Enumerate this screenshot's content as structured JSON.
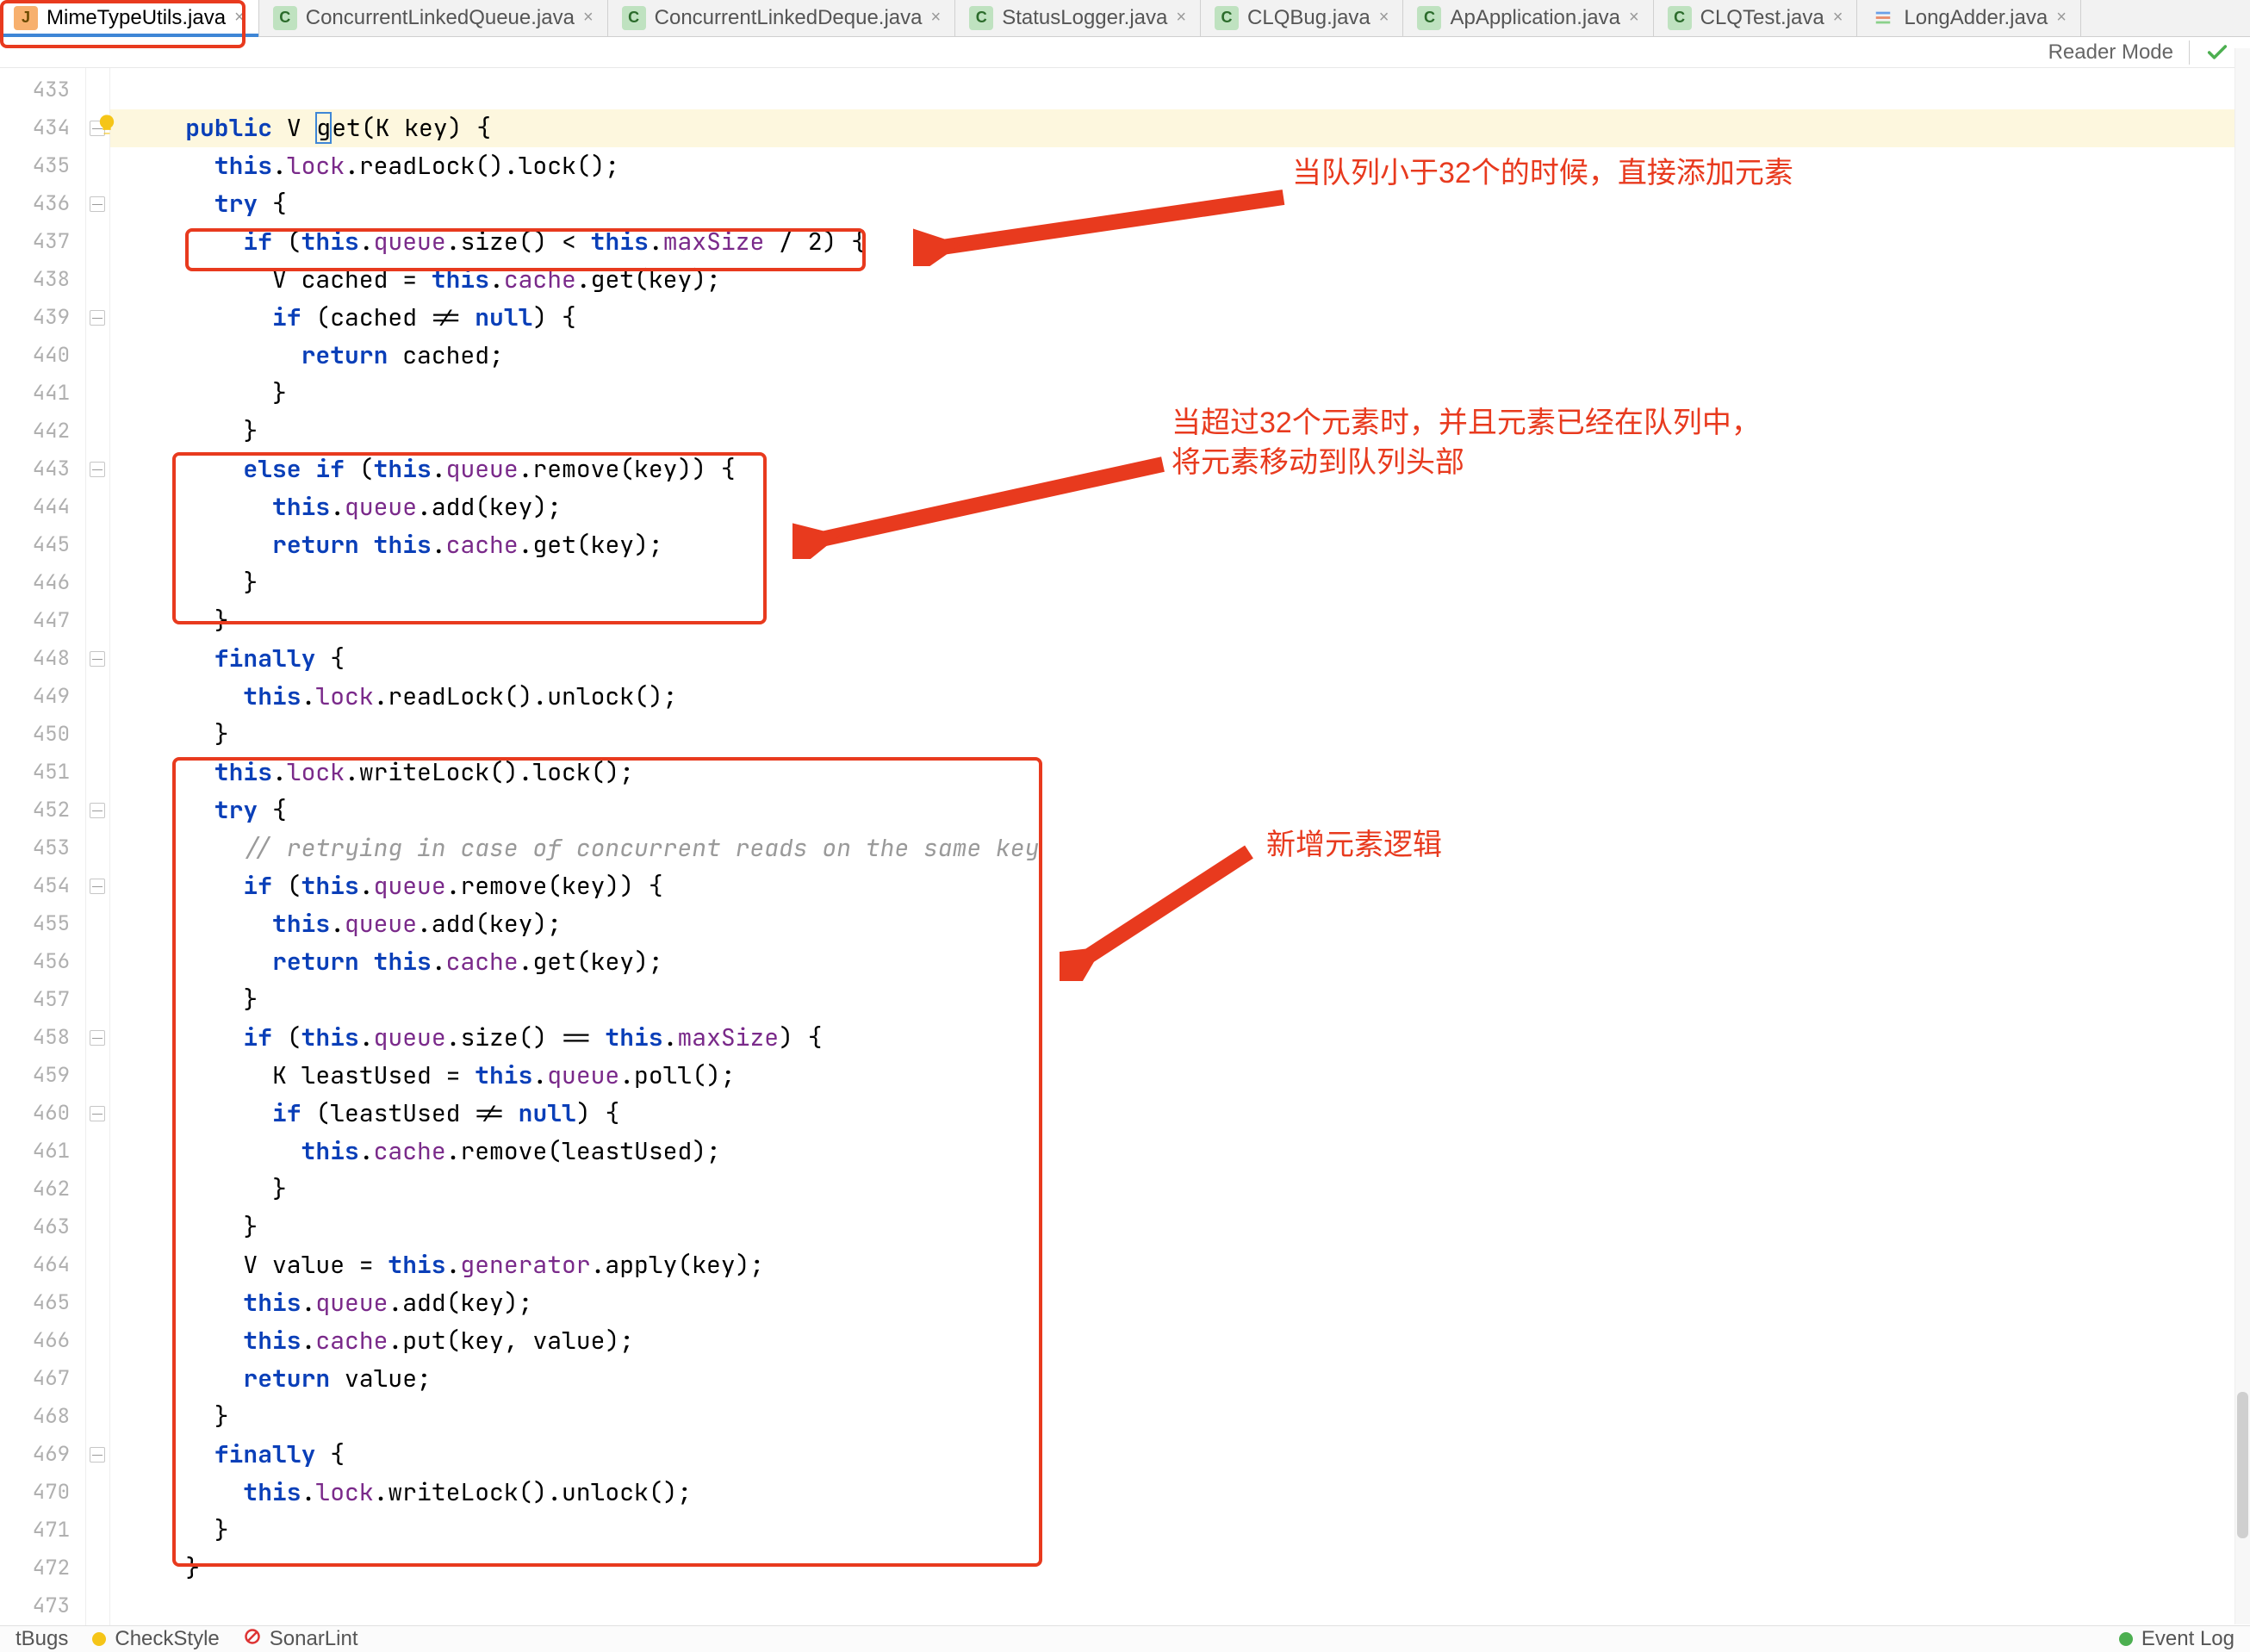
{
  "tabs": [
    {
      "label": "MimeTypeUtils.java",
      "icon": "j",
      "active": true
    },
    {
      "label": "ConcurrentLinkedQueue.java",
      "icon": "c",
      "active": false
    },
    {
      "label": "ConcurrentLinkedDeque.java",
      "icon": "c",
      "active": false
    },
    {
      "label": "StatusLogger.java",
      "icon": "c",
      "active": false
    },
    {
      "label": "CLQBug.java",
      "icon": "c",
      "active": false
    },
    {
      "label": "ApApplication.java",
      "icon": "c",
      "active": false
    },
    {
      "label": "CLQTest.java",
      "icon": "c",
      "active": false
    },
    {
      "label": "LongAdder.java",
      "icon": "bars",
      "active": false
    }
  ],
  "reader_mode_label": "Reader Mode",
  "line_start": 433,
  "line_end": 473,
  "code_lines": [
    {
      "n": 433,
      "html": ""
    },
    {
      "n": 434,
      "html": "<span class='kw'>public</span> V <span class='caret'>g</span>et(K key) {",
      "hl": true
    },
    {
      "n": 435,
      "html": "  <span class='kw'>this</span>.<span class='fld'>lock</span>.readLock().lock();"
    },
    {
      "n": 436,
      "html": "  <span class='kw'>try</span> {"
    },
    {
      "n": 437,
      "html": "    <span class='kw'>if</span> (<span class='kw'>this</span>.<span class='fld'>queue</span>.size() &lt; <span class='kw'>this</span>.<span class='fld'>maxSize</span> / 2) {"
    },
    {
      "n": 438,
      "html": "      V cached = <span class='kw'>this</span>.<span class='fld'>cache</span>.get(key);"
    },
    {
      "n": 439,
      "html": "      <span class='kw'>if</span> (cached != <span class='kw'>null</span>) {"
    },
    {
      "n": 440,
      "html": "        <span class='kw'>return</span> cached;"
    },
    {
      "n": 441,
      "html": "      }"
    },
    {
      "n": 442,
      "html": "    }"
    },
    {
      "n": 443,
      "html": "    <span class='kw'>else if</span> (<span class='kw'>this</span>.<span class='fld'>queue</span>.remove(key)) {"
    },
    {
      "n": 444,
      "html": "      <span class='kw'>this</span>.<span class='fld'>queue</span>.add(key);"
    },
    {
      "n": 445,
      "html": "      <span class='kw'>return</span> <span class='kw'>this</span>.<span class='fld'>cache</span>.get(key);"
    },
    {
      "n": 446,
      "html": "    }"
    },
    {
      "n": 447,
      "html": "  }"
    },
    {
      "n": 448,
      "html": "  <span class='kw'>finally</span> {"
    },
    {
      "n": 449,
      "html": "    <span class='kw'>this</span>.<span class='fld'>lock</span>.readLock().unlock();"
    },
    {
      "n": 450,
      "html": "  }"
    },
    {
      "n": 451,
      "html": "  <span class='kw'>this</span>.<span class='fld'>lock</span>.writeLock().lock();"
    },
    {
      "n": 452,
      "html": "  <span class='kw'>try</span> {"
    },
    {
      "n": 453,
      "html": "    <span class='cmt'>// retrying in case of concurrent reads on the same key</span>"
    },
    {
      "n": 454,
      "html": "    <span class='kw'>if</span> (<span class='kw'>this</span>.<span class='fld'>queue</span>.remove(key)) {"
    },
    {
      "n": 455,
      "html": "      <span class='kw'>this</span>.<span class='fld'>queue</span>.add(key);"
    },
    {
      "n": 456,
      "html": "      <span class='kw'>return</span> <span class='kw'>this</span>.<span class='fld'>cache</span>.get(key);"
    },
    {
      "n": 457,
      "html": "    }"
    },
    {
      "n": 458,
      "html": "    <span class='kw'>if</span> (<span class='kw'>this</span>.<span class='fld'>queue</span>.size() == <span class='kw'>this</span>.<span class='fld'>maxSize</span>) {"
    },
    {
      "n": 459,
      "html": "      K leastUsed = <span class='kw'>this</span>.<span class='fld'>queue</span>.poll();"
    },
    {
      "n": 460,
      "html": "      <span class='kw'>if</span> (leastUsed != <span class='kw'>null</span>) {"
    },
    {
      "n": 461,
      "html": "        <span class='kw'>this</span>.<span class='fld'>cache</span>.remove(leastUsed);"
    },
    {
      "n": 462,
      "html": "      }"
    },
    {
      "n": 463,
      "html": "    }"
    },
    {
      "n": 464,
      "html": "    V value = <span class='kw'>this</span>.<span class='fld'>generator</span>.apply(key);"
    },
    {
      "n": 465,
      "html": "    <span class='kw'>this</span>.<span class='fld'>queue</span>.add(key);"
    },
    {
      "n": 466,
      "html": "    <span class='kw'>this</span>.<span class='fld'>cache</span>.put(key, value);"
    },
    {
      "n": 467,
      "html": "    <span class='kw'>return</span> value;"
    },
    {
      "n": 468,
      "html": "  }"
    },
    {
      "n": 469,
      "html": "  <span class='kw'>finally</span> {"
    },
    {
      "n": 470,
      "html": "    <span class='kw'>this</span>.<span class='fld'>lock</span>.writeLock().unlock();"
    },
    {
      "n": 471,
      "html": "  }"
    },
    {
      "n": 472,
      "html": "}"
    },
    {
      "n": 473,
      "html": ""
    }
  ],
  "annotations": {
    "a1": "当队列小于32个的时候，直接添加元素",
    "a2": "当超过32个元素时，并且元素已经在队列中，\n将元素移动到队列头部",
    "a3": "新增元素逻辑"
  },
  "status": {
    "s1": "tBugs",
    "s2": "CheckStyle",
    "s3": "SonarLint",
    "s4": "Event Log"
  }
}
